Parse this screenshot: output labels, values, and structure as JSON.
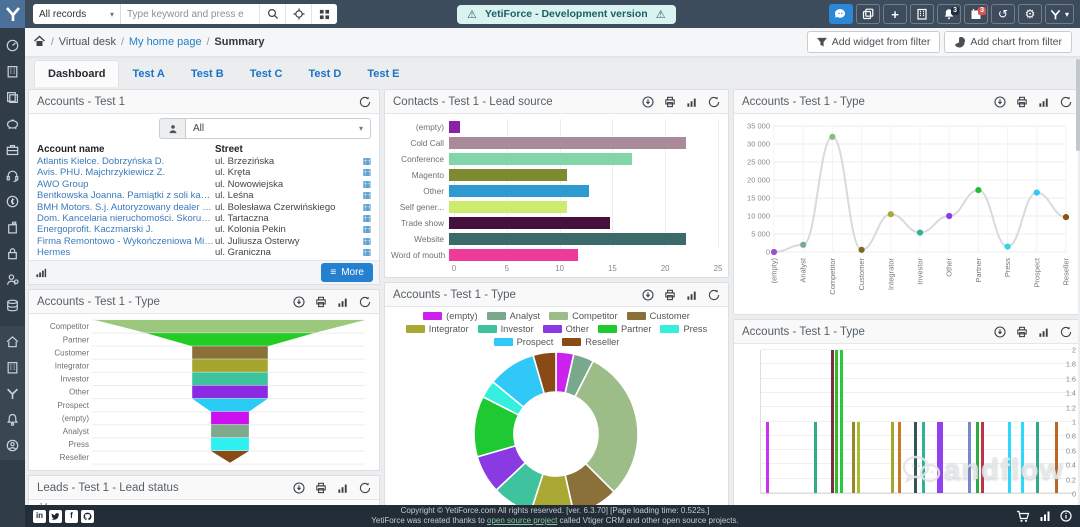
{
  "app": {
    "accent": "#2581c4",
    "navbar_color": "#3d4c5c",
    "sidebar_color": "#303c48",
    "warning_bg": "#d9f4f0",
    "warning_text": "#1d5d66"
  },
  "topbar": {
    "record_select": "All records",
    "search_placeholder": "Type keyword and press e",
    "warning": "YetiForce - Development version",
    "icons": [
      "chat-icon",
      "tags-icon",
      "plus-icon",
      "organization-icon",
      "bell-icon",
      "calendar-icon",
      "history-icon",
      "gear-icon",
      "user-menu-icon"
    ],
    "bell_badge": "3",
    "calendar_badge": "3"
  },
  "breadcrumb": {
    "items": [
      "Virtual desk",
      "My home page",
      "Summary"
    ]
  },
  "toolbar": {
    "add_widget": "Add widget from filter",
    "add_chart": "Add chart from filter"
  },
  "tabs": {
    "items": [
      "Dashboard",
      "Test A",
      "Test B",
      "Test C",
      "Test D",
      "Test E"
    ],
    "active": "Dashboard"
  },
  "sidebar": {
    "items": [
      "dashboard",
      "companies",
      "documents",
      "piggy-bank",
      "briefcase",
      "support",
      "finance",
      "projects",
      "security",
      "contacts",
      "database",
      "home",
      "organization",
      "yetiforce-mark",
      "notifications",
      "profile"
    ]
  },
  "accounts_widget": {
    "title": "Accounts - Test 1",
    "filter_value": "All",
    "columns": [
      "Account name",
      "Street"
    ],
    "rows": [
      {
        "name": "Atlantis Kielce. Dobrzyńska D.",
        "street": "ul. Brzezińska"
      },
      {
        "name": "Avis. PHU. Majchrzykiewicz Z.",
        "street": "ul. Kręta"
      },
      {
        "name": "AWO Group",
        "street": "ul. Nowowiejska"
      },
      {
        "name": "Bentkowska Joanna. Pamiątki z soli kamiennej",
        "street": "ul. Leśna"
      },
      {
        "name": "BMH Motors. S.j. Autoryzowany dealer Nissan",
        "street": "ul. Bolesława Czerwińskiego"
      },
      {
        "name": "Dom. Kancelaria nieruchomości. Skorupka J.",
        "street": "ul. Tartaczna"
      },
      {
        "name": "Energoprofit. Kaczmarski J.",
        "street": "ul. Kolonia Pekin"
      },
      {
        "name": "Firma Remontowo - Wykończeniowa Mir - Rem M...",
        "street": "ul. Juliusza Osterwy"
      },
      {
        "name": "Hermes",
        "street": "ul. Graniczna"
      }
    ],
    "more_label": "More"
  },
  "funnel_widget": {
    "title": "Accounts - Test 1 - Type"
  },
  "leadsource_widget": {
    "title": "Contacts - Test 1 - Lead source"
  },
  "donut_widget": {
    "title": "Accounts - Test 1 - Type"
  },
  "line_widget": {
    "title": "Accounts - Test 1 - Type"
  },
  "bars_widget": {
    "title": "Accounts - Test 1 - Type"
  },
  "leads_widget": {
    "title": "Leads - Test 1 - Lead status",
    "partial_tick": "14"
  },
  "chart_data": [
    {
      "id": "lead_source",
      "type": "bar",
      "orientation": "horizontal",
      "title": "Contacts - Test 1 - Lead source",
      "categories": [
        "(empty)",
        "Cold Call",
        "Conference",
        "Magento",
        "Other",
        "Self gener...",
        "Trade show",
        "Website",
        "Word of mouth"
      ],
      "values": [
        1,
        22,
        17,
        11,
        13,
        11,
        15,
        22,
        12
      ],
      "colors": [
        "#8a22a8",
        "#a88a99",
        "#82d4a9",
        "#7e8a30",
        "#2f9ad0",
        "#cdeb6e",
        "#46103c",
        "#3c6a6a",
        "#ee3a99"
      ],
      "xlim": [
        0,
        25
      ],
      "xticks": [
        0,
        5,
        10,
        15,
        20,
        25
      ],
      "grid": true,
      "legend": false
    },
    {
      "id": "type_line",
      "type": "line",
      "title": "Accounts - Test 1 - Type",
      "categories": [
        "(empty)",
        "Analyst",
        "Competitor",
        "Customer",
        "Integrator",
        "Investor",
        "Other",
        "Partner",
        "Press",
        "Prospect",
        "Reseller"
      ],
      "values": [
        0,
        2000,
        32000,
        600,
        10500,
        5400,
        10000,
        17200,
        1500,
        16500,
        9700
      ],
      "point_colors": [
        "#9b4fd4",
        "#79a88d",
        "#8abb7a",
        "#7a6a1e",
        "#a8a832",
        "#2eb392",
        "#8a3aee",
        "#1fbf2f",
        "#2ed8e8",
        "#2ec8fa",
        "#8a520f"
      ],
      "line_color": "#d8dadc",
      "ylim": [
        0,
        35000
      ],
      "yticks": [
        "0",
        "5 000",
        "10 000",
        "15 000",
        "20 000",
        "25 000",
        "30 000",
        "35 000"
      ],
      "grid": true,
      "legend": false
    },
    {
      "id": "type_funnel",
      "type": "funnel",
      "title": "Accounts - Test 1 - Type",
      "categories": [
        "Competitor",
        "Partner",
        "Customer",
        "Integrator",
        "Investor",
        "Other",
        "Prospect",
        "(empty)",
        "Analyst",
        "Press",
        "Reseller"
      ],
      "colors": [
        "#9cc87e",
        "#22cc22",
        "#8a713a",
        "#a6a62e",
        "#3cc49c",
        "#8a2be2",
        "#29ccf5",
        "#cc10f0",
        "#7fa98c",
        "#2ef0f0",
        "#8a4a14"
      ],
      "segment_widths_percent": [
        [
          100,
          62
        ],
        [
          62,
          28
        ],
        [
          28,
          28
        ],
        [
          28,
          28
        ],
        [
          28,
          28
        ],
        [
          28,
          28
        ],
        [
          28,
          14
        ],
        [
          14,
          14
        ],
        [
          14,
          14
        ],
        [
          14,
          14
        ],
        [
          14,
          0
        ]
      ]
    },
    {
      "id": "type_donut",
      "type": "pie",
      "donut": true,
      "title": "Accounts - Test 1 - Type",
      "categories": [
        "(empty)",
        "Analyst",
        "Competitor",
        "Customer",
        "Integrator",
        "Investor",
        "Other",
        "Partner",
        "Press",
        "Prospect",
        "Reseller"
      ],
      "values_percent": [
        3.5,
        4,
        30,
        9,
        8.5,
        8,
        7.5,
        12,
        3.5,
        9.5,
        4.5
      ],
      "colors": [
        "#cb22ee",
        "#79a88d",
        "#9dbd88",
        "#8a713a",
        "#a8a832",
        "#3fc39e",
        "#8a3ae2",
        "#1ec932",
        "#35eedd",
        "#2fc8f7",
        "#8a4a16"
      ],
      "legend_position": "top"
    },
    {
      "id": "type_bars",
      "type": "bar",
      "orientation": "vertical",
      "title": "Accounts - Test 1 - Type",
      "ylim": [
        0,
        2
      ],
      "yticks": [
        "0",
        "0.2",
        "0.4",
        "0.6",
        "0.8",
        "1",
        "1.2",
        "1.4",
        "1.6",
        "1.8",
        "2"
      ],
      "bars": [
        {
          "x_percent": 1.5,
          "value": 1,
          "color": "#cc33ee"
        },
        {
          "x_percent": 17,
          "value": 1,
          "color": "#33aa88"
        },
        {
          "x_percent": 22.3,
          "value": 2,
          "color": "#7a2e3e"
        },
        {
          "x_percent": 23.8,
          "value": 2,
          "color": "#2ebb2e"
        },
        {
          "x_percent": 25.2,
          "value": 2,
          "color": "#23cc3c"
        },
        {
          "x_percent": 29,
          "value": 1,
          "color": "#99882a"
        },
        {
          "x_percent": 30.6,
          "value": 1,
          "color": "#aabb33"
        },
        {
          "x_percent": 41.5,
          "value": 1,
          "color": "#a6a62e"
        },
        {
          "x_percent": 43.7,
          "value": 1,
          "color": "#cc7722"
        },
        {
          "x_percent": 49,
          "value": 1,
          "color": "#33555a"
        },
        {
          "x_percent": 51.3,
          "value": 1,
          "color": "#2eb392"
        },
        {
          "x_percent": 56.3,
          "value": 1,
          "color": "#9340ee",
          "width": 6
        },
        {
          "x_percent": 66,
          "value": 1,
          "color": "#7788cc"
        },
        {
          "x_percent": 68.8,
          "value": 1,
          "color": "#2eaa44"
        },
        {
          "x_percent": 70.3,
          "value": 1,
          "color": "#bb3344"
        },
        {
          "x_percent": 79,
          "value": 1,
          "color": "#2ed8fa"
        },
        {
          "x_percent": 83,
          "value": 1,
          "color": "#2ed8fa"
        },
        {
          "x_percent": 88,
          "value": 1,
          "color": "#2eaa88"
        },
        {
          "x_percent": 94,
          "value": 1,
          "color": "#bb6622"
        }
      ]
    }
  ],
  "footer": {
    "copyright": "Copyright © YetiForce.com All rights reserved. [ver. 6.3.70] [Page loading time: 0.522s.]",
    "credits_prefix": "YetiForce was created thanks to ",
    "credits_link": "open source project",
    "credits_suffix": " called Vtiger CRM and other open source projects.",
    "social_icons": [
      "linkedin-icon",
      "twitter-icon",
      "facebook-icon",
      "github-icon"
    ],
    "right_icons": [
      "cart-icon",
      "usage-chart-icon",
      "info-icon"
    ]
  },
  "watermark": {
    "text": "andflow"
  }
}
